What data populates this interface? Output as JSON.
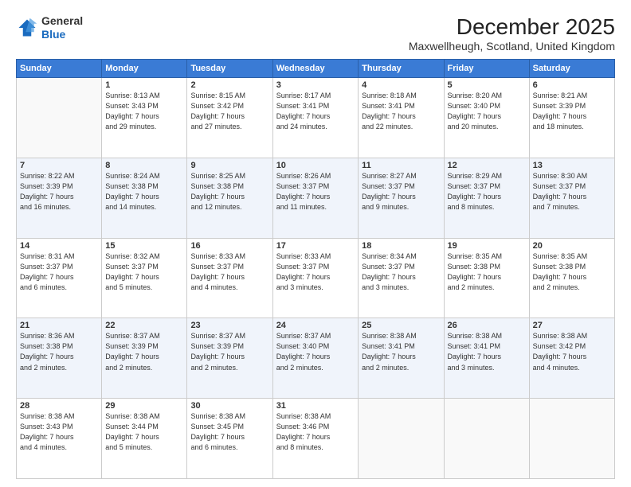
{
  "logo": {
    "general": "General",
    "blue": "Blue"
  },
  "header": {
    "month": "December 2025",
    "location": "Maxwellheugh, Scotland, United Kingdom"
  },
  "weekdays": [
    "Sunday",
    "Monday",
    "Tuesday",
    "Wednesday",
    "Thursday",
    "Friday",
    "Saturday"
  ],
  "weeks": [
    [
      {
        "day": "",
        "info": ""
      },
      {
        "day": "1",
        "info": "Sunrise: 8:13 AM\nSunset: 3:43 PM\nDaylight: 7 hours\nand 29 minutes."
      },
      {
        "day": "2",
        "info": "Sunrise: 8:15 AM\nSunset: 3:42 PM\nDaylight: 7 hours\nand 27 minutes."
      },
      {
        "day": "3",
        "info": "Sunrise: 8:17 AM\nSunset: 3:41 PM\nDaylight: 7 hours\nand 24 minutes."
      },
      {
        "day": "4",
        "info": "Sunrise: 8:18 AM\nSunset: 3:41 PM\nDaylight: 7 hours\nand 22 minutes."
      },
      {
        "day": "5",
        "info": "Sunrise: 8:20 AM\nSunset: 3:40 PM\nDaylight: 7 hours\nand 20 minutes."
      },
      {
        "day": "6",
        "info": "Sunrise: 8:21 AM\nSunset: 3:39 PM\nDaylight: 7 hours\nand 18 minutes."
      }
    ],
    [
      {
        "day": "7",
        "info": "Sunrise: 8:22 AM\nSunset: 3:39 PM\nDaylight: 7 hours\nand 16 minutes."
      },
      {
        "day": "8",
        "info": "Sunrise: 8:24 AM\nSunset: 3:38 PM\nDaylight: 7 hours\nand 14 minutes."
      },
      {
        "day": "9",
        "info": "Sunrise: 8:25 AM\nSunset: 3:38 PM\nDaylight: 7 hours\nand 12 minutes."
      },
      {
        "day": "10",
        "info": "Sunrise: 8:26 AM\nSunset: 3:37 PM\nDaylight: 7 hours\nand 11 minutes."
      },
      {
        "day": "11",
        "info": "Sunrise: 8:27 AM\nSunset: 3:37 PM\nDaylight: 7 hours\nand 9 minutes."
      },
      {
        "day": "12",
        "info": "Sunrise: 8:29 AM\nSunset: 3:37 PM\nDaylight: 7 hours\nand 8 minutes."
      },
      {
        "day": "13",
        "info": "Sunrise: 8:30 AM\nSunset: 3:37 PM\nDaylight: 7 hours\nand 7 minutes."
      }
    ],
    [
      {
        "day": "14",
        "info": "Sunrise: 8:31 AM\nSunset: 3:37 PM\nDaylight: 7 hours\nand 6 minutes."
      },
      {
        "day": "15",
        "info": "Sunrise: 8:32 AM\nSunset: 3:37 PM\nDaylight: 7 hours\nand 5 minutes."
      },
      {
        "day": "16",
        "info": "Sunrise: 8:33 AM\nSunset: 3:37 PM\nDaylight: 7 hours\nand 4 minutes."
      },
      {
        "day": "17",
        "info": "Sunrise: 8:33 AM\nSunset: 3:37 PM\nDaylight: 7 hours\nand 3 minutes."
      },
      {
        "day": "18",
        "info": "Sunrise: 8:34 AM\nSunset: 3:37 PM\nDaylight: 7 hours\nand 3 minutes."
      },
      {
        "day": "19",
        "info": "Sunrise: 8:35 AM\nSunset: 3:38 PM\nDaylight: 7 hours\nand 2 minutes."
      },
      {
        "day": "20",
        "info": "Sunrise: 8:35 AM\nSunset: 3:38 PM\nDaylight: 7 hours\nand 2 minutes."
      }
    ],
    [
      {
        "day": "21",
        "info": "Sunrise: 8:36 AM\nSunset: 3:38 PM\nDaylight: 7 hours\nand 2 minutes."
      },
      {
        "day": "22",
        "info": "Sunrise: 8:37 AM\nSunset: 3:39 PM\nDaylight: 7 hours\nand 2 minutes."
      },
      {
        "day": "23",
        "info": "Sunrise: 8:37 AM\nSunset: 3:39 PM\nDaylight: 7 hours\nand 2 minutes."
      },
      {
        "day": "24",
        "info": "Sunrise: 8:37 AM\nSunset: 3:40 PM\nDaylight: 7 hours\nand 2 minutes."
      },
      {
        "day": "25",
        "info": "Sunrise: 8:38 AM\nSunset: 3:41 PM\nDaylight: 7 hours\nand 2 minutes."
      },
      {
        "day": "26",
        "info": "Sunrise: 8:38 AM\nSunset: 3:41 PM\nDaylight: 7 hours\nand 3 minutes."
      },
      {
        "day": "27",
        "info": "Sunrise: 8:38 AM\nSunset: 3:42 PM\nDaylight: 7 hours\nand 4 minutes."
      }
    ],
    [
      {
        "day": "28",
        "info": "Sunrise: 8:38 AM\nSunset: 3:43 PM\nDaylight: 7 hours\nand 4 minutes."
      },
      {
        "day": "29",
        "info": "Sunrise: 8:38 AM\nSunset: 3:44 PM\nDaylight: 7 hours\nand 5 minutes."
      },
      {
        "day": "30",
        "info": "Sunrise: 8:38 AM\nSunset: 3:45 PM\nDaylight: 7 hours\nand 6 minutes."
      },
      {
        "day": "31",
        "info": "Sunrise: 8:38 AM\nSunset: 3:46 PM\nDaylight: 7 hours\nand 8 minutes."
      },
      {
        "day": "",
        "info": ""
      },
      {
        "day": "",
        "info": ""
      },
      {
        "day": "",
        "info": ""
      }
    ]
  ]
}
